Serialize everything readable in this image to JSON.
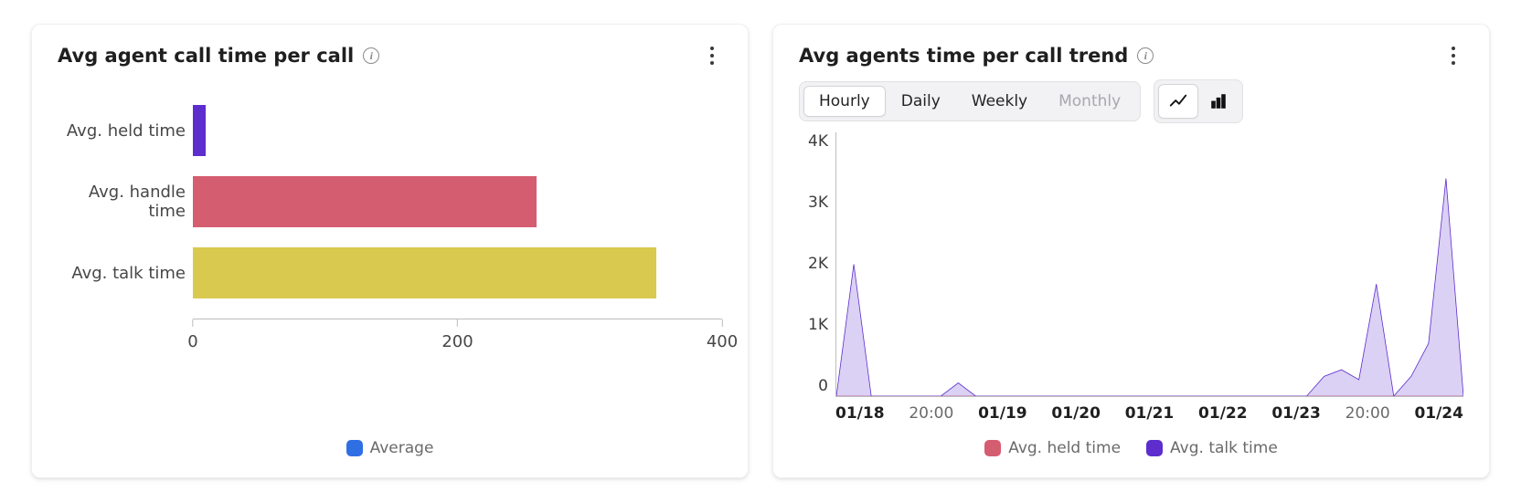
{
  "left": {
    "title": "Avg agent call time per call",
    "legend": "Average",
    "legend_color": "#2f6fe4",
    "axis_ticks": [
      "0",
      "200",
      "400"
    ]
  },
  "right": {
    "title": "Avg agents time per call trend",
    "toggles": {
      "hourly": "Hourly",
      "daily": "Daily",
      "weekly": "Weekly",
      "monthly": "Monthly"
    },
    "y_ticks": [
      "4K",
      "3K",
      "2K",
      "1K",
      "0"
    ],
    "x_ticks": [
      "01/18",
      "20:00",
      "01/19",
      "01/20",
      "01/21",
      "01/22",
      "01/23",
      "20:00",
      "01/24"
    ],
    "legend_held": "Avg. held time",
    "legend_talk": "Avg. talk time"
  },
  "chart_data": [
    {
      "type": "bar",
      "orientation": "horizontal",
      "title": "Avg agent call time per call",
      "xlabel": "",
      "ylabel": "",
      "xlim": [
        0,
        400
      ],
      "categories": [
        "Avg. held time",
        "Avg. handle time",
        "Avg. talk time"
      ],
      "values": [
        10,
        260,
        350
      ],
      "colors": [
        "#5d2dcd",
        "#d55d70",
        "#d9c94e"
      ],
      "legend": [
        "Average"
      ]
    },
    {
      "type": "line",
      "title": "Avg agents time per call trend",
      "xlabel": "",
      "ylabel": "",
      "ylim": [
        0,
        4000
      ],
      "x": [
        "01/18 00:00",
        "01/18 04:00",
        "01/18 08:00",
        "01/18 12:00",
        "01/18 16:00",
        "01/18 20:00",
        "01/19 00:00",
        "01/19 04:00",
        "01/19 08:00",
        "01/19 12:00",
        "01/19 16:00",
        "01/19 20:00",
        "01/20 00:00",
        "01/20 04:00",
        "01/20 08:00",
        "01/20 12:00",
        "01/20 16:00",
        "01/20 20:00",
        "01/21 00:00",
        "01/21 04:00",
        "01/21 08:00",
        "01/21 12:00",
        "01/21 16:00",
        "01/21 20:00",
        "01/22 00:00",
        "01/22 04:00",
        "01/22 08:00",
        "01/22 12:00",
        "01/22 16:00",
        "01/22 20:00",
        "01/23 00:00",
        "01/23 04:00",
        "01/23 08:00",
        "01/23 12:00",
        "01/23 16:00",
        "01/23 20:00",
        "01/24 00:00"
      ],
      "series": [
        {
          "name": "Avg. held time",
          "color": "#d55d70",
          "values": [
            0,
            0,
            0,
            0,
            0,
            0,
            0,
            0,
            0,
            0,
            0,
            0,
            0,
            0,
            0,
            0,
            0,
            0,
            0,
            0,
            0,
            0,
            0,
            0,
            0,
            0,
            0,
            0,
            0,
            0,
            0,
            0,
            0,
            0,
            0,
            0,
            0
          ]
        },
        {
          "name": "Avg. talk time",
          "color": "#5d2dcd",
          "values": [
            0,
            2000,
            0,
            0,
            0,
            0,
            0,
            200,
            0,
            0,
            0,
            0,
            0,
            0,
            0,
            0,
            0,
            0,
            0,
            0,
            0,
            0,
            0,
            0,
            0,
            0,
            0,
            0,
            300,
            400,
            250,
            1700,
            0,
            300,
            800,
            3300,
            0
          ]
        }
      ]
    }
  ]
}
